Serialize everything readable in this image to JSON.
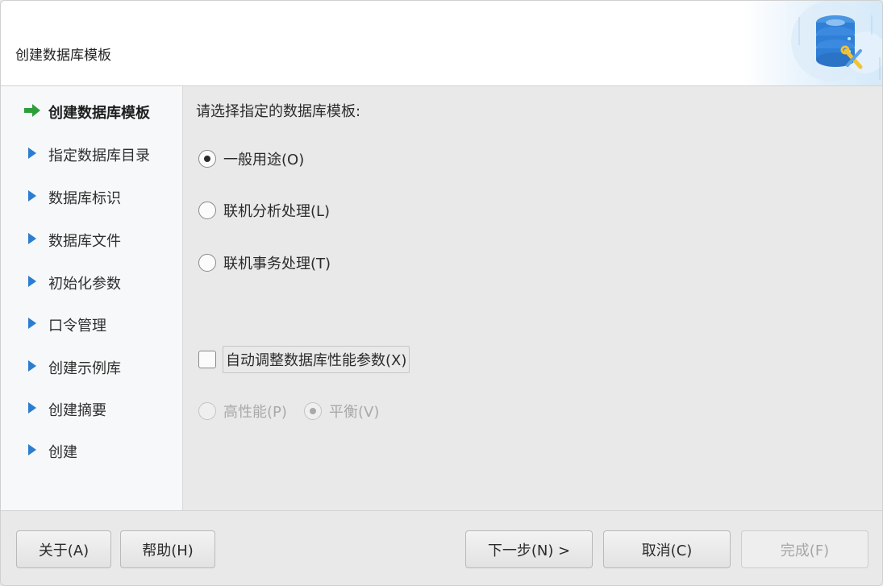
{
  "window": {
    "title": "创建数据库模板"
  },
  "sidebar": {
    "steps": [
      {
        "label": "创建数据库模板",
        "state": "current",
        "icon": "green-arrow-icon"
      },
      {
        "label": "指定数据库目录",
        "state": "pending",
        "icon": "blue-triangle-icon"
      },
      {
        "label": "数据库标识",
        "state": "pending",
        "icon": "blue-triangle-icon"
      },
      {
        "label": "数据库文件",
        "state": "pending",
        "icon": "blue-triangle-icon"
      },
      {
        "label": "初始化参数",
        "state": "pending",
        "icon": "blue-triangle-icon"
      },
      {
        "label": "口令管理",
        "state": "pending",
        "icon": "blue-triangle-icon"
      },
      {
        "label": "创建示例库",
        "state": "pending",
        "icon": "blue-triangle-icon"
      },
      {
        "label": "创建摘要",
        "state": "pending",
        "icon": "blue-triangle-icon"
      },
      {
        "label": "创建",
        "state": "pending",
        "icon": "blue-triangle-icon"
      }
    ]
  },
  "main": {
    "prompt": "请选择指定的数据库模板:",
    "templates": [
      {
        "label": "一般用途(O)",
        "selected": true
      },
      {
        "label": "联机分析处理(L)",
        "selected": false
      },
      {
        "label": "联机事务处理(T)",
        "selected": false
      }
    ],
    "auto_tune": {
      "label": "自动调整数据库性能参数(X)",
      "checked": false
    },
    "performance": [
      {
        "label": "高性能(P)",
        "selected": false,
        "enabled": false
      },
      {
        "label": "平衡(V)",
        "selected": true,
        "enabled": false
      }
    ]
  },
  "footer": {
    "about": "关于(A)",
    "help": "帮助(H)",
    "next": "下一步(N) >",
    "cancel": "取消(C)",
    "finish": "完成(F)"
  },
  "colors": {
    "current_arrow": "#2e9e3a",
    "step_triangle": "#2c7dd1",
    "header_art_blue": "#2f7fd6"
  }
}
